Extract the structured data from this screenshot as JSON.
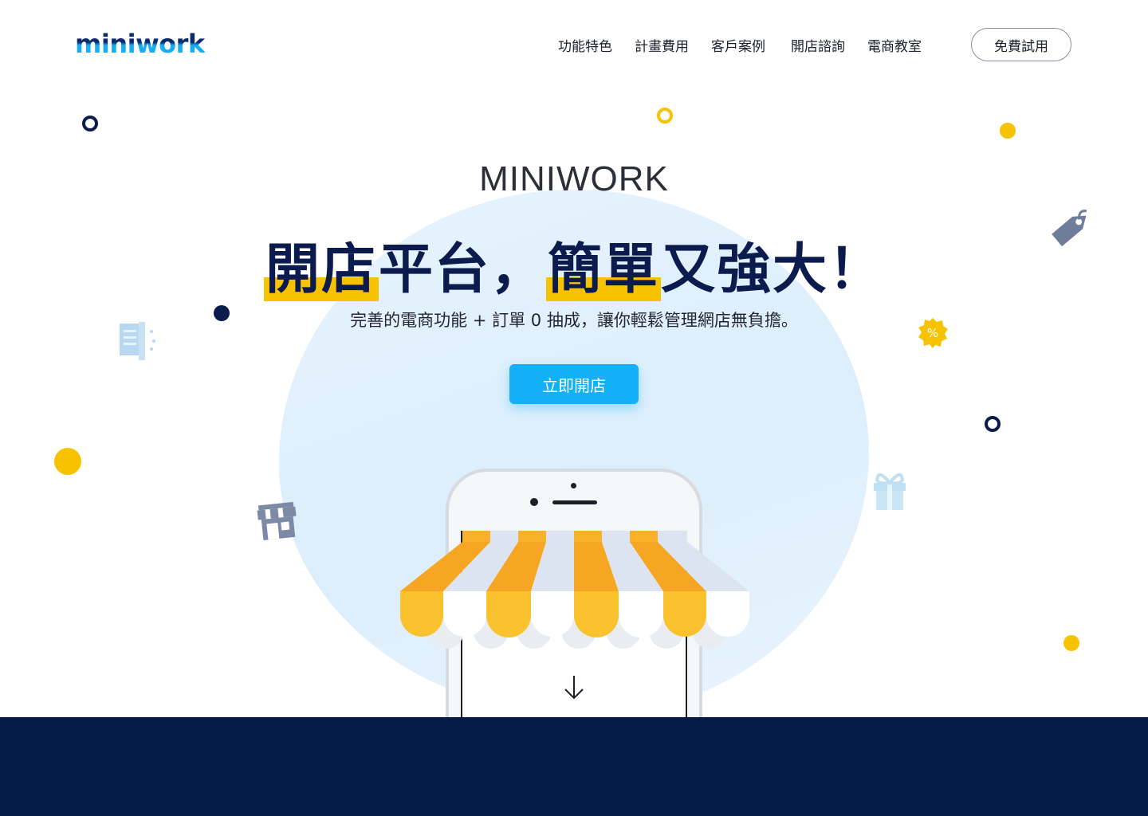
{
  "brand": {
    "logo": "miniwork"
  },
  "nav": {
    "items": [
      "功能特色",
      "計畫費用",
      "客戶案例",
      "開店諮詢",
      "電商教室"
    ],
    "cta": "免費試用"
  },
  "hero": {
    "eyebrow": "MINIWORK",
    "headline": {
      "part1_hl": "開店",
      "part2": "平台，",
      "part3_hl": "簡單",
      "part4": "又強大！"
    },
    "subtitle": "完善的電商功能 + 訂單 0 抽成，讓你輕鬆管理網店無負擔。",
    "cta": "立即開店"
  },
  "colors": {
    "navy": "#0b1b4e",
    "accent_blue": "#12b0f5",
    "yellow": "#f7c200",
    "footer": "#051947"
  },
  "icons": [
    "tag-icon",
    "receipt-icon",
    "percent-badge-icon",
    "gift-icon",
    "store-icon",
    "arrow-down-icon"
  ]
}
